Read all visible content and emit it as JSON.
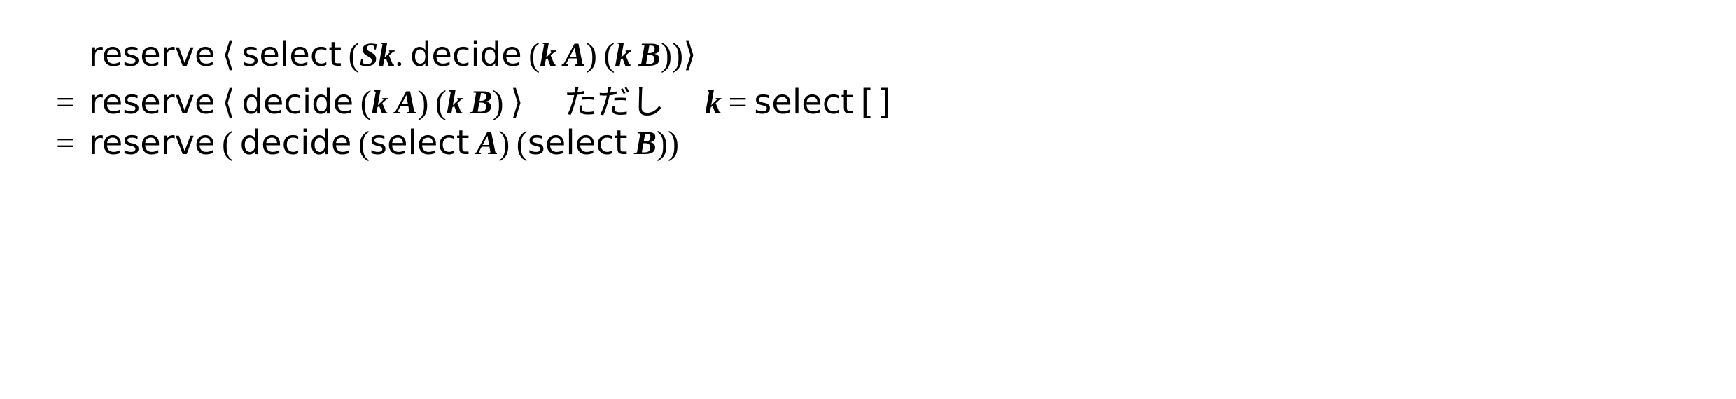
{
  "lines": [
    {
      "eq": "",
      "reserve": "reserve",
      "la": "⟨",
      "select": "select",
      "lp1": "(",
      "S": "S",
      "k": "k",
      "dot": ".",
      "decide": "decide",
      "lp2": "(",
      "k2": "k",
      "A": "A",
      "rp2": ")",
      "lp3": "(",
      "k3": "k",
      "B": "B",
      "rp3": ")",
      "rp1": ")",
      "ra": "⟩"
    },
    {
      "eq": "=",
      "reserve": "reserve",
      "la": "⟨",
      "decide": "decide",
      "lp1": "(",
      "k1": "k",
      "A": "A",
      "rp1": ")",
      "lp2": "(",
      "k2": "k",
      "B": "B",
      "rp2": ")",
      "ra": "⟩",
      "tadashi": "ただし",
      "k_eq_l": "k",
      "eqsym": "=",
      "select": "select",
      "hole": "[ ]"
    },
    {
      "eq": "=",
      "reserve": "reserve",
      "lp0": "(",
      "decide": "decide",
      "lp1": "(",
      "select1": "select",
      "A": "A",
      "rp1": ")",
      "lp2": "(",
      "select2": "select",
      "B": "B",
      "rp2": ")",
      "rp0": ")"
    }
  ]
}
